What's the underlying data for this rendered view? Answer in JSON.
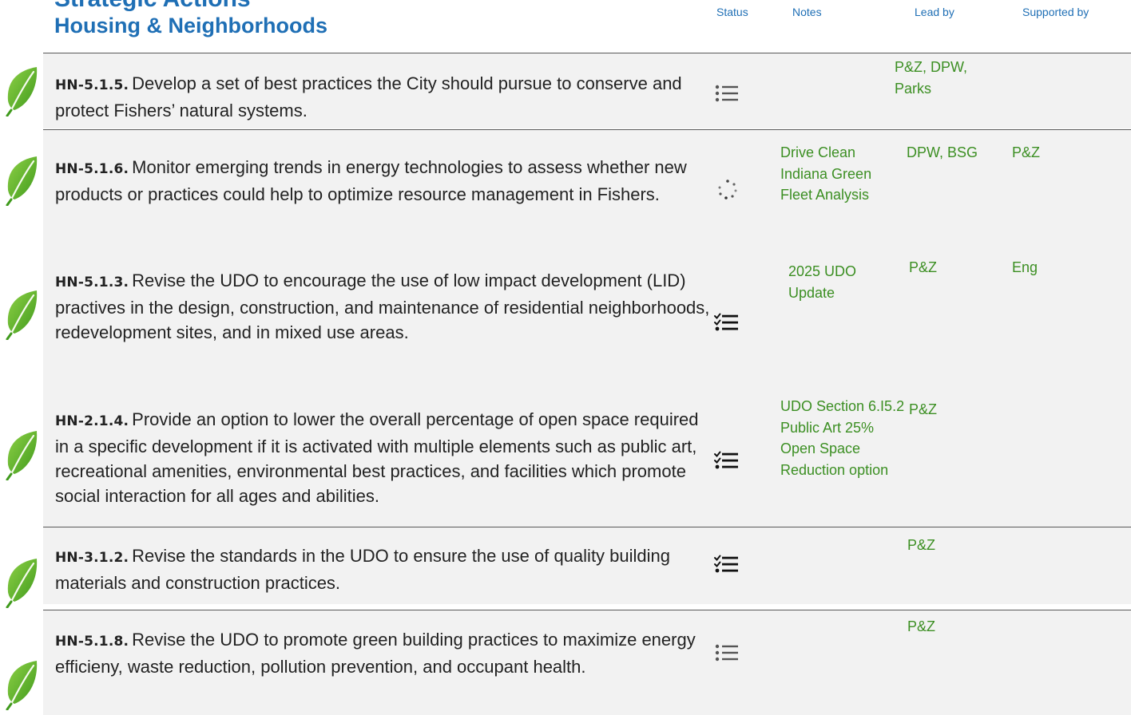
{
  "header": {
    "title": "Strategic Actions",
    "subtitle": "Housing & Neighborhoods",
    "columns": {
      "status": "Status",
      "notes": "Notes",
      "lead": "Lead by",
      "supported": "Supported by"
    }
  },
  "colors": {
    "heading": "#1f6fb5",
    "cell_text": "#3c8f23",
    "leaf": "#6cba2c",
    "row_bg": "#f2f2f2"
  },
  "rows": [
    {
      "code": "HN-5.1.5.",
      "text": "Develop a set of best practices the City should pursue to conserve and protect Fishers’ natural systems.",
      "status_icon": "list-icon",
      "notes": "",
      "lead": "P&Z, DPW, Parks",
      "supported": ""
    },
    {
      "code": "HN-5.1.6.",
      "text": "Monitor emerging trends in energy technologies to assess whether new products or practices could help to optimize resource management in Fishers.",
      "status_icon": "spinner-icon",
      "notes": "Drive Clean Indiana Green Fleet Analysis",
      "lead": "DPW, BSG",
      "supported": "P&Z"
    },
    {
      "code": "HN-5.1.3.",
      "text": "Revise the UDO to encourage the use of low impact development (LID) practives in the design, construction, and maintenance of residential neighborhoods, redevelopment sites, and in mixed use areas.",
      "status_icon": "checklist-icon",
      "notes": "2025 UDO Update",
      "lead": "P&Z",
      "supported": "Eng"
    },
    {
      "code": "HN-2.1.4.",
      "text": "Provide an option to lower the overall percentage of open space required in a specific development if it is activated with multiple elements such as public art, recreational amenities, environmental best practices, and facilities which promote social interaction for all ages and abilities.",
      "status_icon": "checklist-icon",
      "notes": "UDO Section 6.I5.2 Public Art 25% Open Space Reduction option",
      "lead": "P&Z",
      "supported": ""
    },
    {
      "code": "HN-3.1.2.",
      "text": "Revise the standards in the UDO to ensure the use of quality building materials and construction practices.",
      "status_icon": "checklist-icon",
      "notes": "",
      "lead": "P&Z",
      "supported": ""
    },
    {
      "code": "HN-5.1.8.",
      "text": "Revise the UDO to promote green building practices to maximize energy efficieny, waste reduction, pollution prevention, and occupant health.",
      "status_icon": "list-icon",
      "notes": "",
      "lead": "P&Z",
      "supported": ""
    }
  ]
}
